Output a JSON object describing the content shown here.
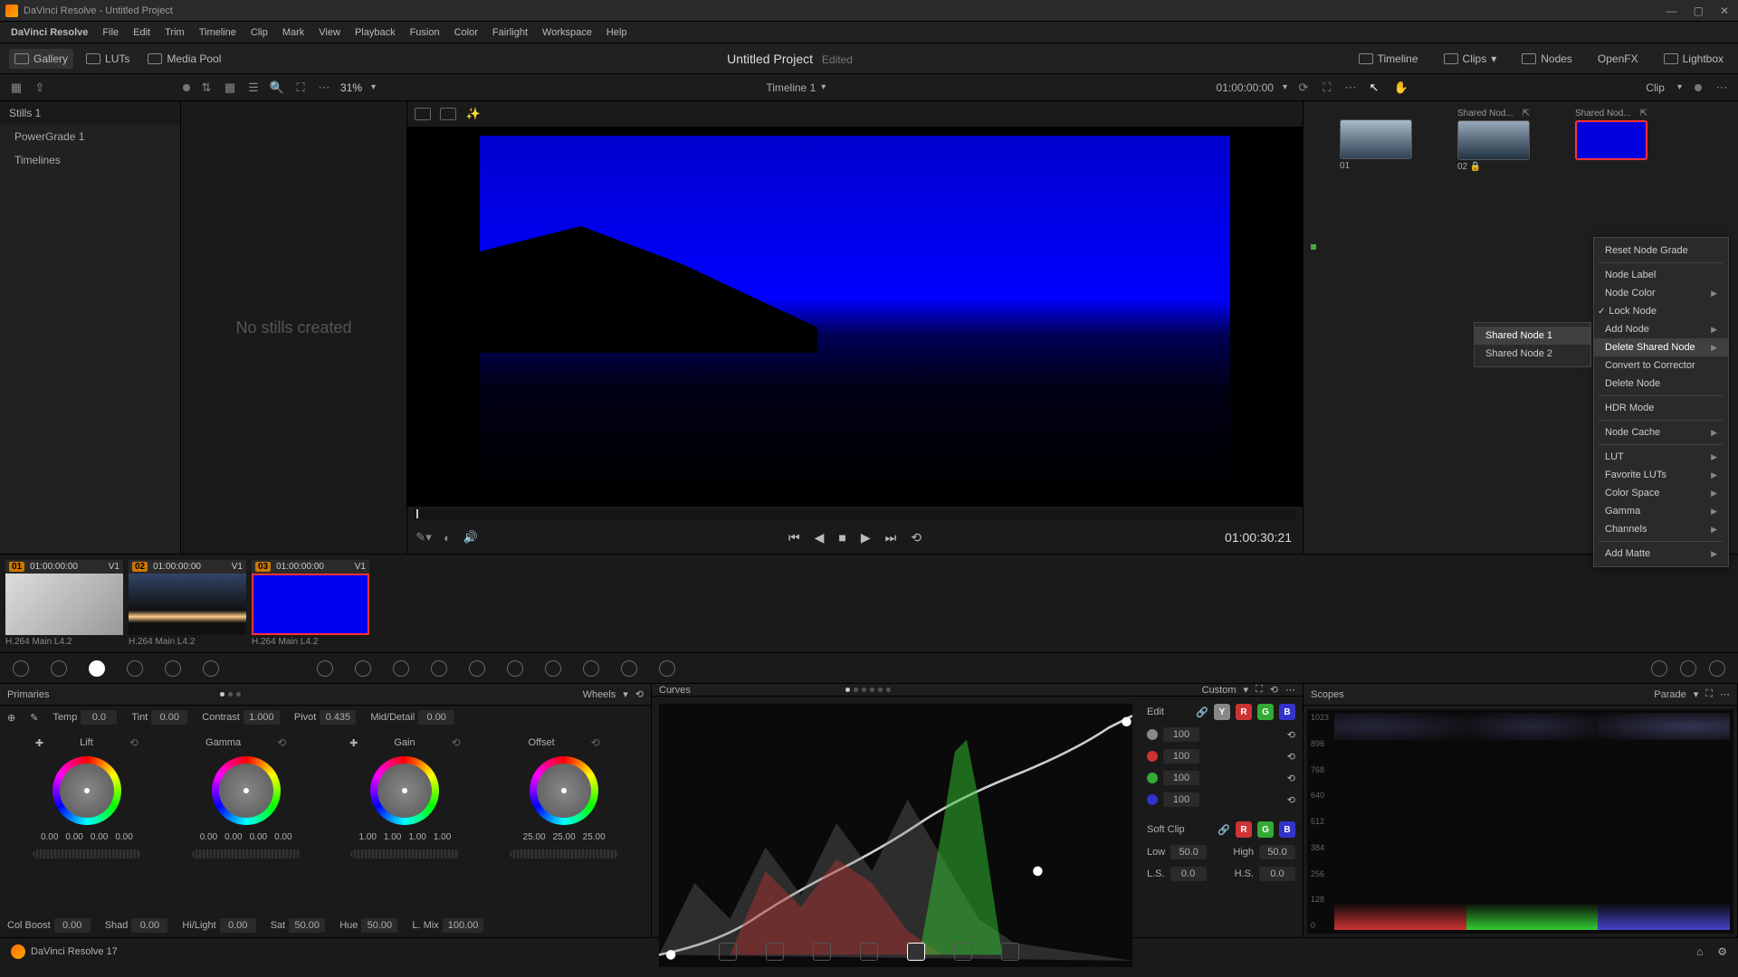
{
  "titlebar": {
    "title": "DaVinci Resolve - Untitled Project"
  },
  "menus": [
    "DaVinci Resolve",
    "File",
    "Edit",
    "Trim",
    "Timeline",
    "Clip",
    "Mark",
    "View",
    "Playback",
    "Fusion",
    "Color",
    "Fairlight",
    "Workspace",
    "Help"
  ],
  "toolbar": {
    "gallery": "Gallery",
    "luts": "LUTs",
    "mediapool": "Media Pool",
    "project": "Untitled Project",
    "status": "Edited",
    "timeline": "Timeline",
    "clips": "Clips",
    "nodes": "Nodes",
    "openfx": "OpenFX",
    "lightbox": "Lightbox"
  },
  "subbar": {
    "zoom": "31%",
    "timeline_name": "Timeline 1",
    "tc": "01:00:00:00",
    "clip_mode": "Clip"
  },
  "stills": {
    "tab": "Stills 1",
    "items": [
      "PowerGrade 1",
      "Timelines"
    ],
    "empty": "No stills created"
  },
  "viewer": {
    "tc": "01:00:30:21"
  },
  "nodes": {
    "n1_label": "",
    "n1_num": "01",
    "n2_label": "Shared Nod...",
    "n2_num": "02",
    "n3_label": "Shared Nod..."
  },
  "context_menu": {
    "reset": "Reset Node Grade",
    "label": "Node Label",
    "color": "Node Color",
    "lock": "Lock Node",
    "addnode": "Add Node",
    "delshared": "Delete Shared Node",
    "convert": "Convert to Corrector",
    "delete": "Delete Node",
    "hdr": "HDR Mode",
    "cache": "Node Cache",
    "lut": "LUT",
    "favluts": "Favorite LUTs",
    "colorspace": "Color Space",
    "gamma": "Gamma",
    "channels": "Channels",
    "addmatte": "Add Matte"
  },
  "submenu": {
    "sn1": "Shared Node 1",
    "sn2": "Shared Node 2"
  },
  "clips": [
    {
      "num": "01",
      "tc": "01:00:00:00",
      "track": "V1",
      "codec": "H.264 Main L4.2"
    },
    {
      "num": "02",
      "tc": "01:00:00:00",
      "track": "V1",
      "codec": "H.264 Main L4.2"
    },
    {
      "num": "03",
      "tc": "01:00:00:00",
      "track": "V1",
      "codec": "H.264 Main L4.2"
    }
  ],
  "primaries": {
    "title": "Primaries",
    "wheels": "Wheels",
    "temp_l": "Temp",
    "temp": "0.0",
    "tint_l": "Tint",
    "tint": "0.00",
    "contrast_l": "Contrast",
    "contrast": "1.000",
    "pivot_l": "Pivot",
    "pivot": "0.435",
    "md_l": "Mid/Detail",
    "md": "0.00",
    "lift": "Lift",
    "gamma": "Gamma",
    "gain": "Gain",
    "offset": "Offset",
    "lift_v": [
      "0.00",
      "0.00",
      "0.00",
      "0.00"
    ],
    "gamma_v": [
      "0.00",
      "0.00",
      "0.00",
      "0.00"
    ],
    "gain_v": [
      "1.00",
      "1.00",
      "1.00",
      "1.00"
    ],
    "offset_v": [
      "25.00",
      "25.00",
      "25.00"
    ],
    "colboost_l": "Col Boost",
    "colboost": "0.00",
    "shad_l": "Shad",
    "shad": "0.00",
    "hilight_l": "Hi/Light",
    "hilight": "0.00",
    "sat_l": "Sat",
    "sat": "50.00",
    "hue_l": "Hue",
    "hue": "50.00",
    "lmix_l": "L. Mix",
    "lmix": "100.00"
  },
  "curves": {
    "title": "Curves",
    "custom": "Custom",
    "edit": "Edit",
    "softclip": "Soft Clip",
    "vals": [
      "100",
      "100",
      "100",
      "100"
    ],
    "low_l": "Low",
    "low": "50.0",
    "high_l": "High",
    "high": "50.0",
    "ls_l": "L.S.",
    "ls": "0.0",
    "hs_l": "H.S.",
    "hs": "0.0"
  },
  "scopes": {
    "title": "Scopes",
    "mode": "Parade",
    "scale": [
      "1023",
      "896",
      "768",
      "640",
      "512",
      "384",
      "256",
      "128",
      "0"
    ]
  },
  "bottombar": {
    "app": "DaVinci Resolve 17"
  }
}
